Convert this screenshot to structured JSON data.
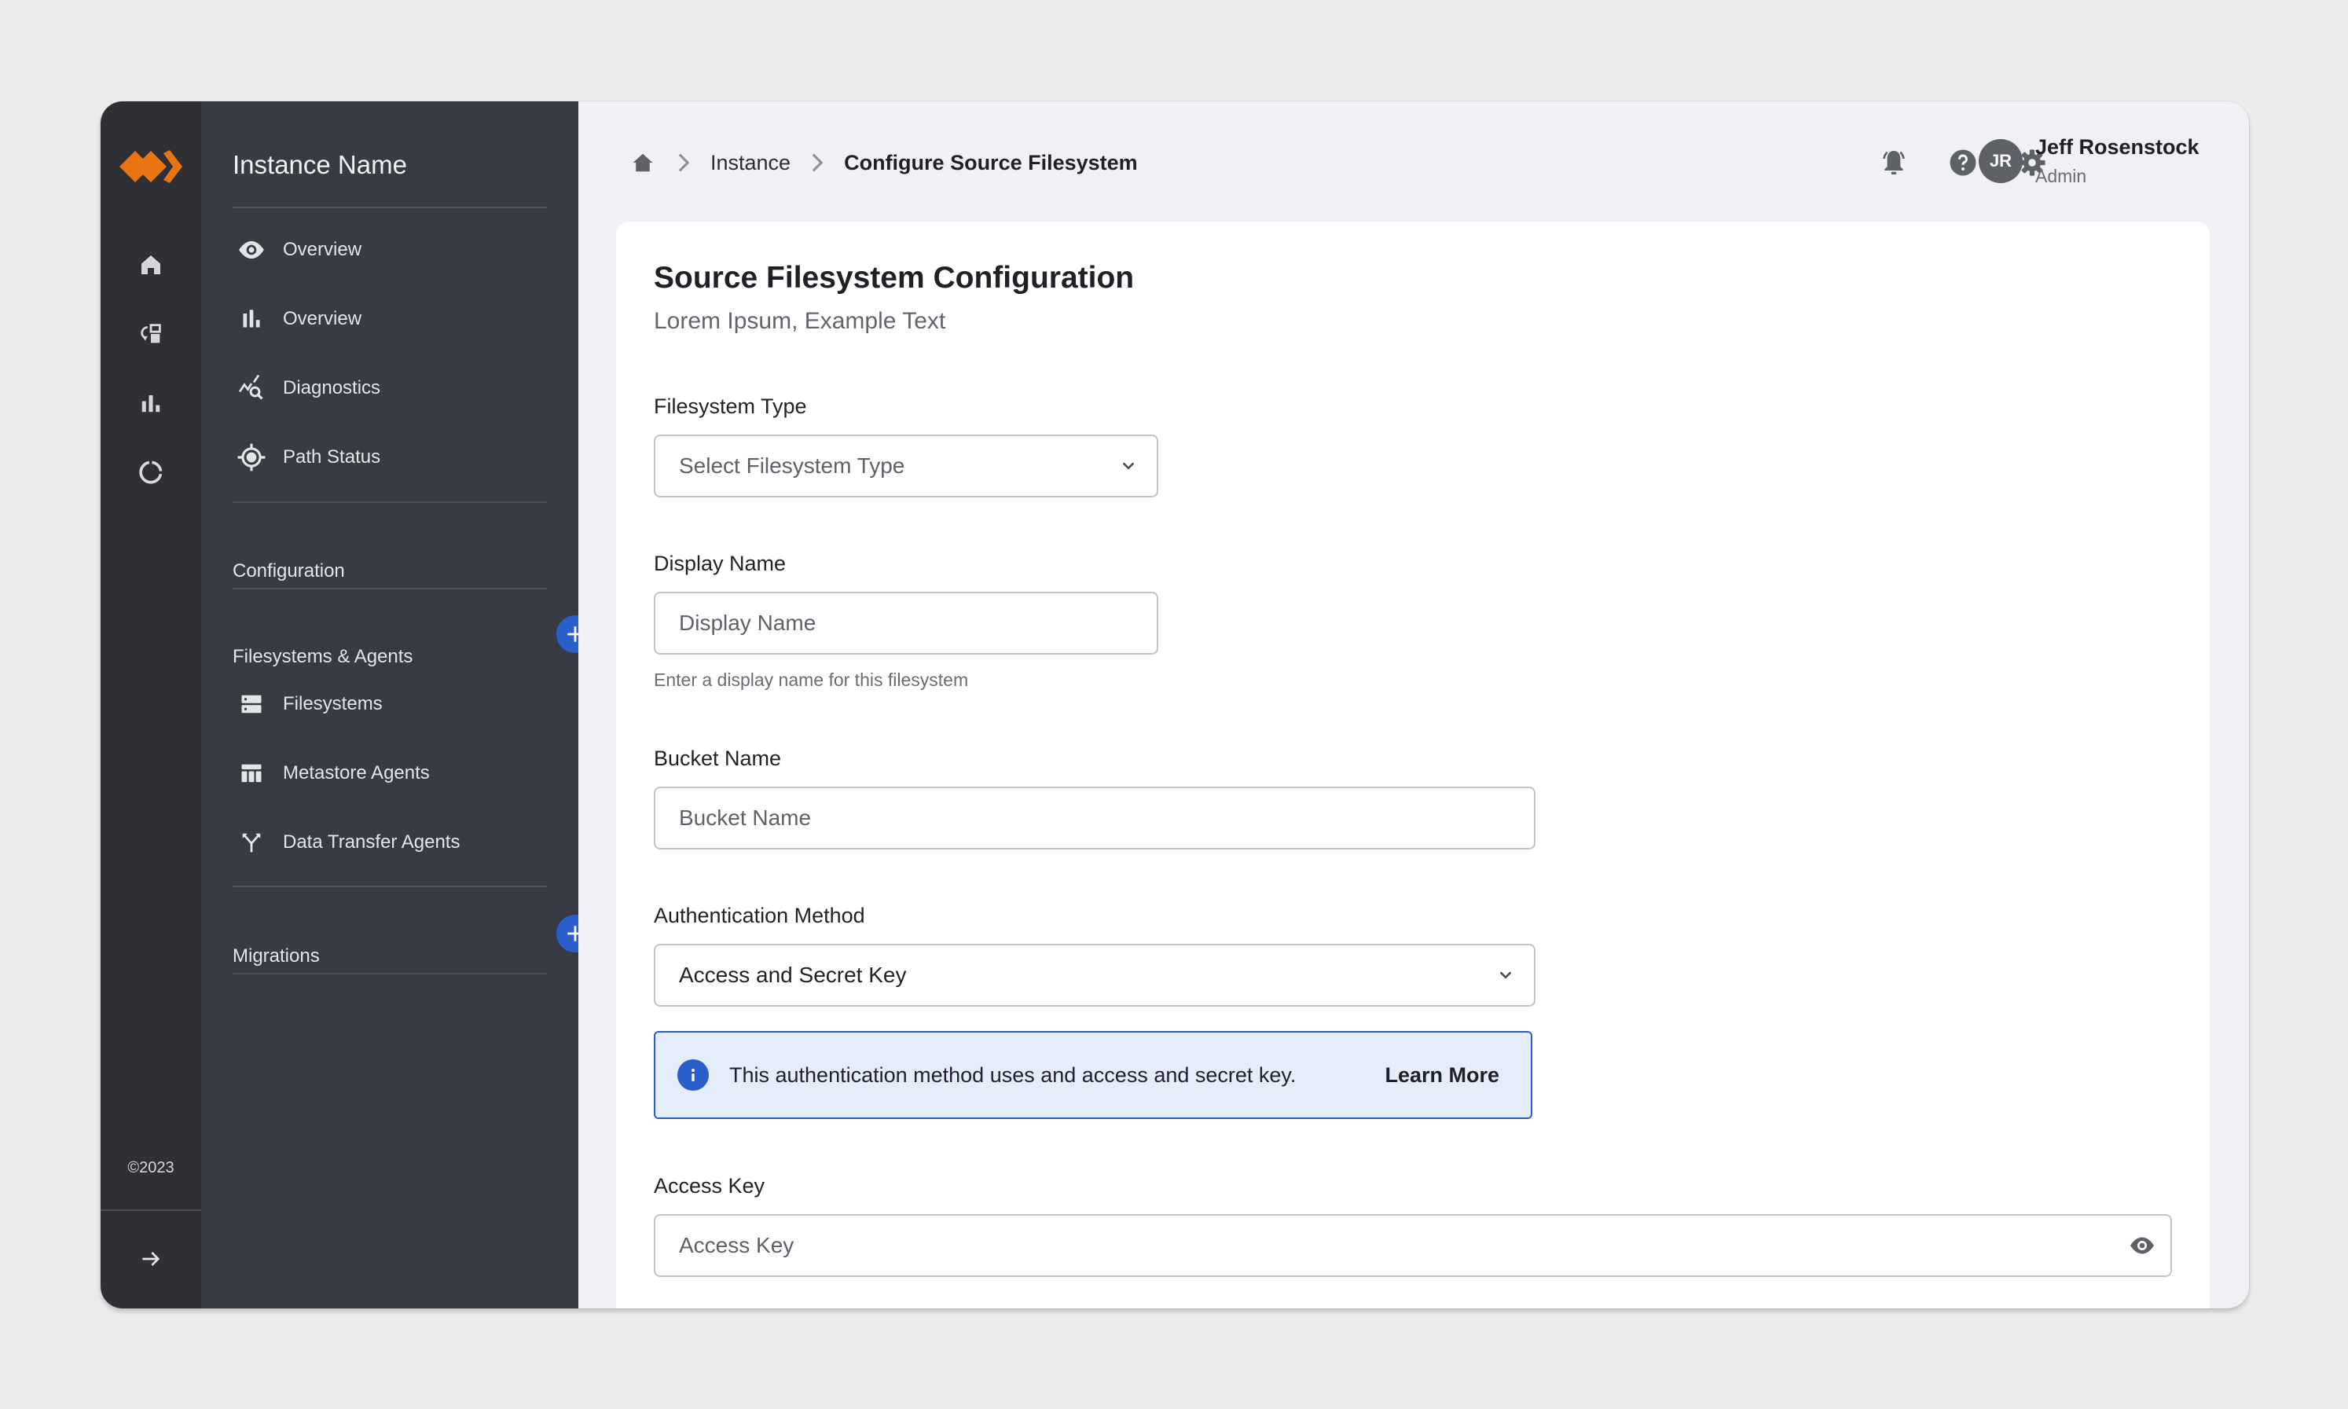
{
  "app": {
    "instance_name": "Instance Name",
    "brand_color": "#E87511",
    "accent_color": "#2A5FCB",
    "copyright": "©2023"
  },
  "rail": {
    "items": [
      {
        "icon": "home-icon",
        "label": "Home"
      },
      {
        "icon": "migration-icon",
        "label": "Migrations"
      },
      {
        "icon": "bar-chart-icon",
        "label": "Analytics"
      },
      {
        "icon": "donut-icon",
        "label": "Status"
      }
    ],
    "expand_icon": "arrow-right-icon"
  },
  "nav": {
    "items": [
      {
        "icon": "eye-icon",
        "label": "Overview"
      },
      {
        "icon": "bar-chart-icon",
        "label": "Overview"
      },
      {
        "icon": "diagnostics-icon",
        "label": "Diagnostics"
      },
      {
        "icon": "target-icon",
        "label": "Path Status"
      }
    ],
    "sections": [
      {
        "label": "Configuration",
        "expanded": false,
        "has_add": false
      },
      {
        "label": "Filesystems & Agents",
        "expanded": true,
        "has_add": true,
        "children": [
          {
            "icon": "storage-icon",
            "label": "Filesystems"
          },
          {
            "icon": "table-icon",
            "label": "Metastore Agents"
          },
          {
            "icon": "merge-icon",
            "label": "Data Transfer Agents"
          }
        ]
      },
      {
        "label": "Migrations",
        "expanded": false,
        "has_add": true
      }
    ]
  },
  "header": {
    "breadcrumb": [
      {
        "label": "Home",
        "icon": "home-icon"
      },
      {
        "label": "Instance"
      },
      {
        "label": "Configure Source Filesystem",
        "current": true
      }
    ],
    "actions": [
      {
        "icon": "bell-icon",
        "label": "Notifications"
      },
      {
        "icon": "help-icon",
        "label": "Help"
      },
      {
        "icon": "gear-icon",
        "label": "Settings"
      }
    ],
    "user": {
      "initials": "JR",
      "name": "Jeff Rosenstock",
      "role": "Admin"
    }
  },
  "form": {
    "title": "Source Filesystem Configuration",
    "subtitle": "Lorem Ipsum, Example Text",
    "filesystem_type": {
      "label": "Filesystem Type",
      "placeholder": "Select Filesystem Type",
      "value": ""
    },
    "display_name": {
      "label": "Display Name",
      "placeholder": "Display Name",
      "value": "",
      "helper": "Enter a display name for this filesystem"
    },
    "bucket_name": {
      "label": "Bucket Name",
      "placeholder": "Bucket Name",
      "value": ""
    },
    "auth_method": {
      "label": "Authentication Method",
      "value": "Access and Secret Key"
    },
    "info_banner": {
      "text": "This authentication method uses and access and secret key.",
      "link": "Learn More"
    },
    "access_key": {
      "label": "Access Key",
      "placeholder": "Access Key",
      "value": ""
    }
  }
}
